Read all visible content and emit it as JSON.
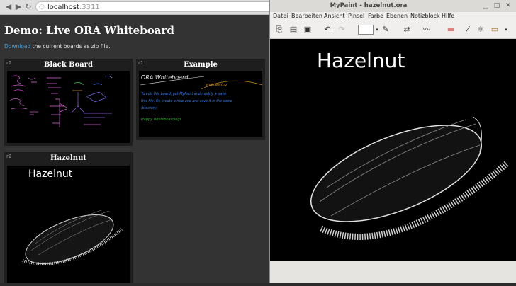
{
  "browser": {
    "url_host": "localhost",
    "url_port": ":3311",
    "back_icon": "back-arrow-icon",
    "forward_icon": "forward-arrow-icon",
    "reload_icon": "reload-icon"
  },
  "page": {
    "title": "Demo: Live ORA Whiteboard",
    "download_link": "Download",
    "download_rest": " the current boards as zip file."
  },
  "boards": [
    {
      "rev": "r2",
      "title": "Black Board"
    },
    {
      "rev": "r1",
      "title": "Example",
      "text_title": "ORA Whiteboard",
      "text_tag": "engineering",
      "text_lines": [
        "To edit this board, get MyPaint and modify + save",
        "this file. Or, create a new one and save it in the same",
        "directory.",
        "Happy Whiteboarding!"
      ]
    },
    {
      "rev": "r2",
      "title": "Hazelnut",
      "drawing_text": "Hazelnut"
    }
  ],
  "mypaint": {
    "title": "MyPaint - hazelnut.ora",
    "menu": [
      "Datei",
      "Bearbeiten",
      "Ansicht",
      "Pinsel",
      "Farbe",
      "Ebenen",
      "Notizblock",
      "Hilfe"
    ],
    "drawing_text": "Hazelnut"
  }
}
